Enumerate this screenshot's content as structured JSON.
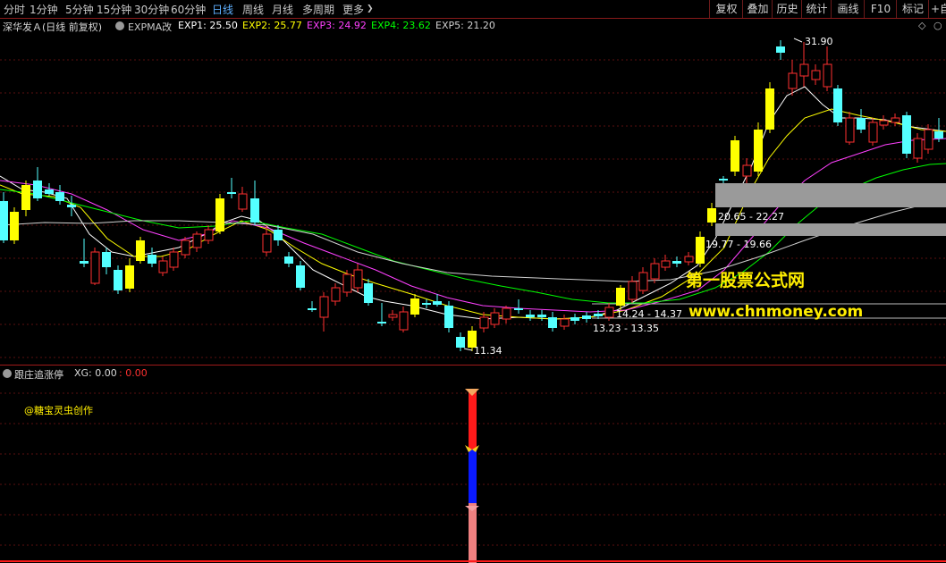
{
  "toolbar": {
    "tabs": [
      "分时",
      "1分钟",
      "5分钟",
      "15分钟",
      "30分钟",
      "60分钟",
      "日线",
      "周线",
      "月线",
      "多周期",
      "更多"
    ],
    "active_tab": "日线",
    "right_buttons": [
      "复权",
      "叠加",
      "历史",
      "统计",
      "画线",
      "F10",
      "标记",
      "+自"
    ]
  },
  "stock": {
    "title": "深华发Ａ(日线 前复权)",
    "indicator": "EXPMA改",
    "exp1": "EXP1: 25.50",
    "exp2": "EXP2: 25.77",
    "exp3": "EXP3: 24.92",
    "exp4": "EXP4: 23.62",
    "exp5": "EXP5: 21.20",
    "colors": {
      "exp1": "#ffffff",
      "exp2": "#ffff00",
      "exp3": "#ff40ff",
      "exp4": "#00ff00",
      "exp5": "#d0d0d0",
      "up": "#ff3030",
      "down": "#54ffff",
      "limit": "#ffff00"
    }
  },
  "annotations": {
    "high": "31.90",
    "low": "11.34",
    "zone1": "20.65 - 22.27",
    "zone2": "19.77 - 19.66",
    "zone3": "14.24 - 14.37",
    "zone4": "13.23 - 13.35",
    "watermark1": "第一股票公式网",
    "watermark2": "www.chnmoney.com"
  },
  "sub_panel": {
    "name": "跟庄追涨停",
    "xg_label": "XG: 0.00",
    "value2": ": 0.00",
    "author": "@糖宝灵虫创作"
  }
}
